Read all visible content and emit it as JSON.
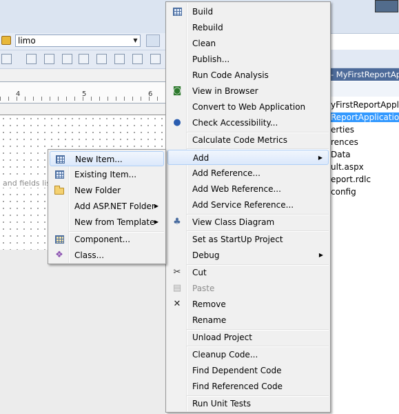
{
  "ide": {
    "project_combo_value": "limo",
    "solution_title": "- MyFirstReportAp",
    "canvas_hint": "and fields list",
    "ruler_numbers": [
      "4",
      "5",
      "6"
    ],
    "solution_items": [
      "yFirstReportApplica",
      "ReportApplication",
      "erties",
      "rences",
      "Data",
      "ult.aspx",
      "eport.rdlc",
      "config"
    ]
  },
  "context_menu": {
    "items": [
      {
        "label": "Build",
        "icon": "build-grid-icon"
      },
      {
        "label": "Rebuild"
      },
      {
        "label": "Clean"
      },
      {
        "label": "Publish..."
      },
      {
        "label": "Run Code Analysis"
      },
      {
        "label": "View in Browser",
        "icon": "browser-icon"
      },
      {
        "label": "Convert to Web Application"
      },
      {
        "label": "Check Accessibility...",
        "icon": "accessibility-icon"
      },
      {
        "label": "Calculate Code Metrics"
      },
      {
        "label": "Add",
        "submenu": true,
        "highlighted": true
      },
      {
        "label": "Add Reference..."
      },
      {
        "label": "Add Web Reference..."
      },
      {
        "label": "Add Service Reference..."
      },
      {
        "label": "View Class Diagram",
        "icon": "class-diagram-icon"
      },
      {
        "label": "Set as StartUp Project"
      },
      {
        "label": "Debug",
        "submenu": true
      },
      {
        "label": "Cut",
        "icon": "scissors-icon"
      },
      {
        "label": "Paste",
        "icon": "paste-icon",
        "disabled": true
      },
      {
        "label": "Remove",
        "icon": "remove-x-icon"
      },
      {
        "label": "Rename"
      },
      {
        "label": "Unload Project"
      },
      {
        "label": "Cleanup Code..."
      },
      {
        "label": "Find Dependent Code"
      },
      {
        "label": "Find Referenced Code"
      },
      {
        "label": "Run Unit Tests"
      }
    ]
  },
  "add_submenu": {
    "items": [
      {
        "label": "New Item...",
        "icon": "new-item-icon",
        "highlighted": true
      },
      {
        "label": "Existing Item...",
        "icon": "existing-item-icon"
      },
      {
        "label": "New Folder",
        "icon": "folder-icon"
      },
      {
        "label": "Add ASP.NET Folder",
        "submenu": true
      },
      {
        "label": "New from Template",
        "submenu": true
      },
      {
        "label": "Component...",
        "icon": "component-icon"
      },
      {
        "label": "Class...",
        "icon": "class-icon"
      }
    ]
  },
  "colors": {
    "highlight_border": "#aecff7",
    "selection_blue": "#3399ff",
    "title_bar": "#4c6a99"
  }
}
